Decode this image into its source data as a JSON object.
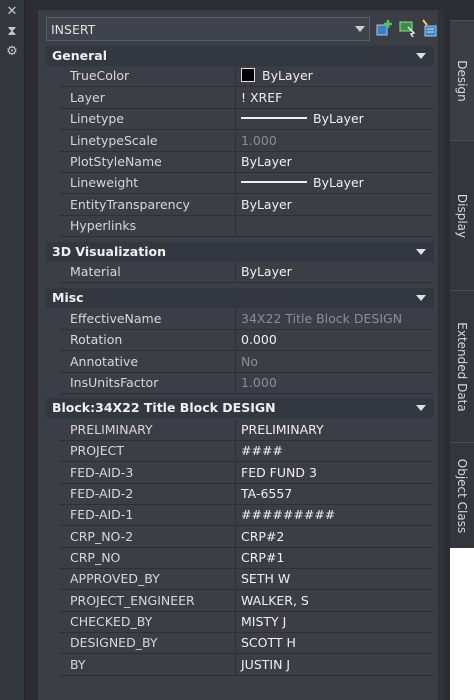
{
  "header": {
    "selected": "INSERT"
  },
  "toolbar": {
    "quick_select_icon": "quick-select-icon",
    "select_objects_icon": "select-objects-icon",
    "toggle_pickadd_icon": "toggle-pickadd-icon"
  },
  "rail": {
    "close": "✕",
    "pin": "⧗",
    "settings": "⚙"
  },
  "sections": {
    "general": {
      "title": "General",
      "rows": [
        {
          "name": "TrueColor",
          "value": "ByLayer"
        },
        {
          "name": "Layer",
          "value": "! XREF"
        },
        {
          "name": "Linetype",
          "value": "ByLayer"
        },
        {
          "name": "LinetypeScale",
          "value": "1.000"
        },
        {
          "name": "PlotStyleName",
          "value": "ByLayer"
        },
        {
          "name": "Lineweight",
          "value": "ByLayer"
        },
        {
          "name": "EntityTransparency",
          "value": "ByLayer"
        },
        {
          "name": "Hyperlinks",
          "value": ""
        }
      ]
    },
    "visualization": {
      "title": "3D Visualization",
      "rows": [
        {
          "name": "Material",
          "value": "ByLayer"
        }
      ]
    },
    "misc": {
      "title": "Misc",
      "rows": [
        {
          "name": "EffectiveName",
          "value": "34X22 Title Block DESIGN"
        },
        {
          "name": "Rotation",
          "value": "0.000"
        },
        {
          "name": "Annotative",
          "value": "No"
        },
        {
          "name": "InsUnitsFactor",
          "value": "1.000"
        }
      ]
    },
    "block": {
      "title": "Block:34X22 Title Block DESIGN",
      "rows": [
        {
          "name": "PRELIMINARY",
          "value": "PRELIMINARY"
        },
        {
          "name": "PROJECT",
          "value": "####"
        },
        {
          "name": "FED-AID-3",
          "value": "FED FUND 3"
        },
        {
          "name": "FED-AID-2",
          "value": "TA-6557"
        },
        {
          "name": "FED-AID-1",
          "value": "#########"
        },
        {
          "name": "CRP_NO-2",
          "value": "CRP#2"
        },
        {
          "name": "CRP_NO",
          "value": "CRP#1"
        },
        {
          "name": "APPROVED_BY",
          "value": "SETH W"
        },
        {
          "name": "PROJECT_ENGINEER",
          "value": "WALKER, S"
        },
        {
          "name": "CHECKED_BY",
          "value": "MISTY J"
        },
        {
          "name": "DESIGNED_BY",
          "value": "SCOTT H"
        },
        {
          "name": "BY",
          "value": "JUSTIN J"
        }
      ]
    }
  },
  "tabs": {
    "design": "Design",
    "display": "Display",
    "extended_data": "Extended Data",
    "object_class": "Object Class"
  },
  "colors": {
    "panel": "#3b3e45",
    "header": "#333740",
    "dim_text": "#8a8d93"
  }
}
